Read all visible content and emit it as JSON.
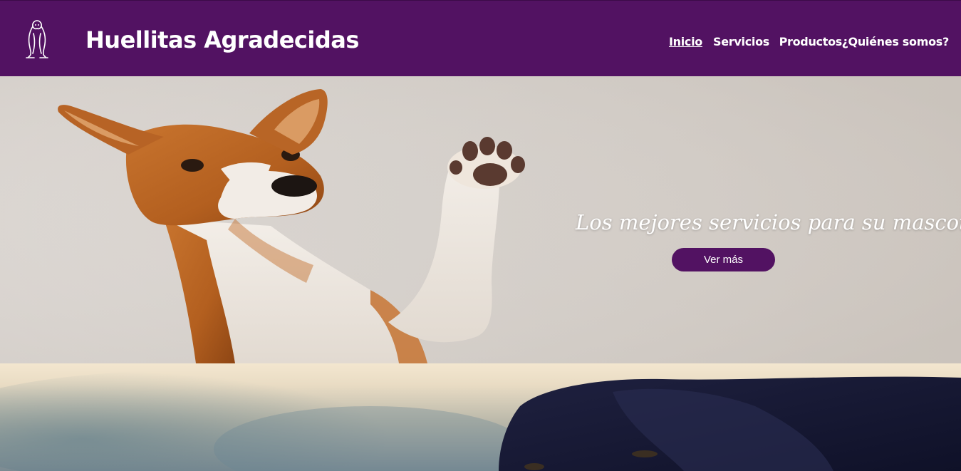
{
  "header": {
    "site_title": "Huellitas Agradecidas",
    "logo_icon": "dog-logo-icon",
    "nav": [
      {
        "label": "Inicio",
        "active": true
      },
      {
        "label": "Servicios",
        "active": false
      },
      {
        "label": "Productos",
        "active": false
      },
      {
        "label": "¿Quiénes somos?",
        "active": false
      }
    ]
  },
  "hero": {
    "tagline": "Los mejores servicios para su mascota",
    "cta_label": "Ver más"
  },
  "colors": {
    "brand": "#521262",
    "hero_background": "#d6d1cc",
    "text_on_brand": "#ffffff"
  }
}
